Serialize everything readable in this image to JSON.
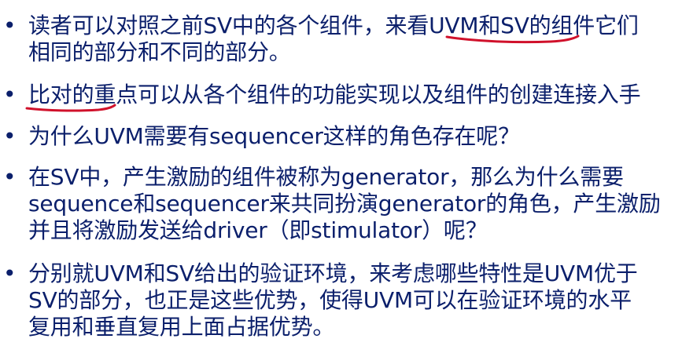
{
  "bullet_symbol": "•",
  "bullets": [
    {
      "lines": [
        "读者可以对照之前SV中的各个组件，来看UVM和SV的组件它们",
        "相同的部分和不同的部分。"
      ]
    },
    {
      "lines": [
        "比对的重点可以从各个组件的功能实现以及组件的创建连接入手"
      ]
    },
    {
      "lines": [
        "为什么UVM需要有sequencer这样的角色存在呢？"
      ]
    },
    {
      "lines": [
        "在SV中，产生激励的组件被称为generator，那么为什么需要",
        "sequence和sequencer来共同扮演generator的角色，产生激励",
        "并且将激励发送给driver（即stimulator）呢？"
      ]
    },
    {
      "lines": [
        "分别就UVM和SV给出的验证环境，来考虑哪些特性是UVM优于",
        "SV的部分，也正是这些优势，使得UVM可以在验证环境的水平",
        "复用和垂直复用上面占据优势。"
      ]
    }
  ],
  "annotation_color": "#d0112b",
  "text_color": "#0b1f6b"
}
